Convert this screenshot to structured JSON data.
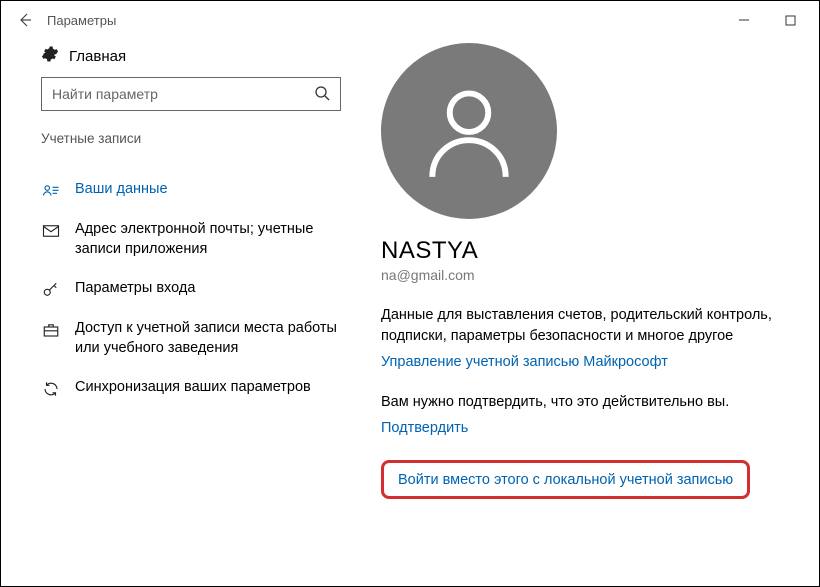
{
  "titlebar": {
    "title": "Параметры"
  },
  "sidebar": {
    "home": "Главная",
    "search_placeholder": "Найти параметр",
    "section": "Учетные записи",
    "items": [
      {
        "label": "Ваши данные"
      },
      {
        "label": "Адрес электронной почты; учетные записи приложения"
      },
      {
        "label": "Параметры входа"
      },
      {
        "label": "Доступ к учетной записи места работы или учебного заведения"
      },
      {
        "label": "Синхронизация ваших параметров"
      }
    ]
  },
  "main": {
    "username": "NASTYA",
    "email": "na@gmail.com",
    "billing_desc": "Данные для выставления счетов, родительский контроль, подписки, параметры безопасности и многое другое",
    "manage_link": "Управление учетной записью Майкрософт",
    "verify_desc": "Вам нужно подтвердить, что это действительно вы.",
    "verify_link": "Подтвердить",
    "local_link": "Войти вместо этого с локальной учетной записью"
  }
}
